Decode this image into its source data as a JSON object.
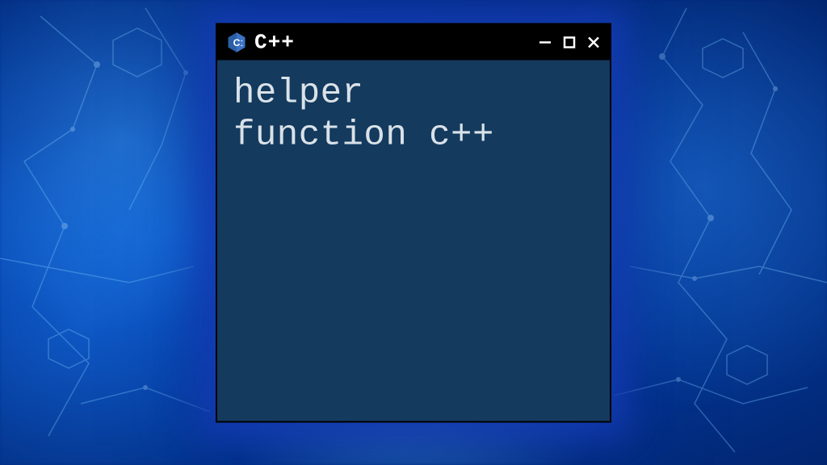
{
  "window": {
    "title": "C++",
    "icon_name": "cpp-logo-icon",
    "content_line1": "helper",
    "content_line2": "function c++"
  },
  "colors": {
    "titlebar_bg": "#000000",
    "content_bg": "#143a5e",
    "text_color": "#d9e2e8"
  }
}
